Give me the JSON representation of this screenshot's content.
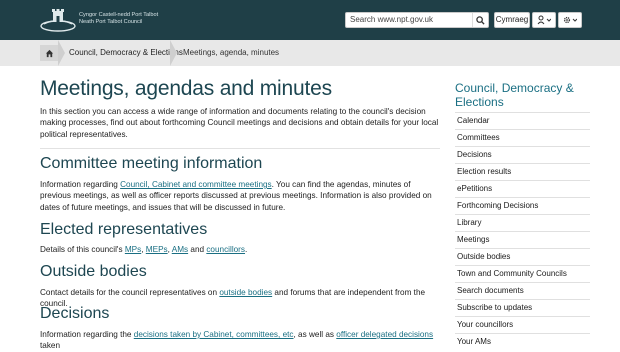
{
  "header": {
    "logo_lines": [
      "Cyngor Castell-nedd Port Talbot",
      "Neath Port Talbot Council",
      ""
    ],
    "search_placeholder": "Search www.npt.gov.uk",
    "language_button": "Cymraeg",
    "account_icon": "user-icon",
    "apps_icon": "gear-icon"
  },
  "breadcrumb": {
    "home_icon": "home-icon",
    "items": [
      "Council, Democracy & Elections",
      "Meetings, agenda, minutes"
    ]
  },
  "main": {
    "title": "Meetings, agendas and minutes",
    "intro": "In this section you can access a wide range of information and documents relating to the council's decision making processes, find out about forthcoming Council meetings and decisions and obtain details for your local political representatives.",
    "sections": [
      {
        "heading": "Committee meeting information",
        "pre": "Information regarding ",
        "link": "Council, Cabinet and committee meetings",
        "post": ". You can find the agendas, minutes of previous meetings, as well as officer reports discussed at previous meetings. Information is also provided on dates of future meetings, and issues that will be discussed in future."
      },
      {
        "heading": "Elected representatives",
        "pre": "Details of this council's ",
        "links": [
          "MPs",
          "MEPs",
          "AMs",
          "councillors"
        ],
        "seps": [
          ", ",
          ", ",
          " and ",
          "."
        ]
      },
      {
        "heading": "Outside bodies",
        "pre": "Contact details for the council representatives on ",
        "link": "outside bodies",
        "post": " and forums that are independent from the council."
      },
      {
        "heading": "Decisions",
        "pre": "Information regarding the ",
        "link": "decisions taken by Cabinet, committees, etc",
        "mid": ", as well as ",
        "link2": "officer delegated decisions",
        "post": " taken"
      }
    ]
  },
  "sidebar": {
    "title": "Council, Democracy & Elections",
    "items": [
      "Calendar",
      "Committees",
      "Decisions",
      "Election results",
      "ePetitions",
      "Forthcoming Decisions",
      "Library",
      "Meetings",
      "Outside bodies",
      "Town and Community Councils",
      "Search documents",
      "Subscribe to updates",
      "Your councillors",
      "Your AMs"
    ]
  }
}
